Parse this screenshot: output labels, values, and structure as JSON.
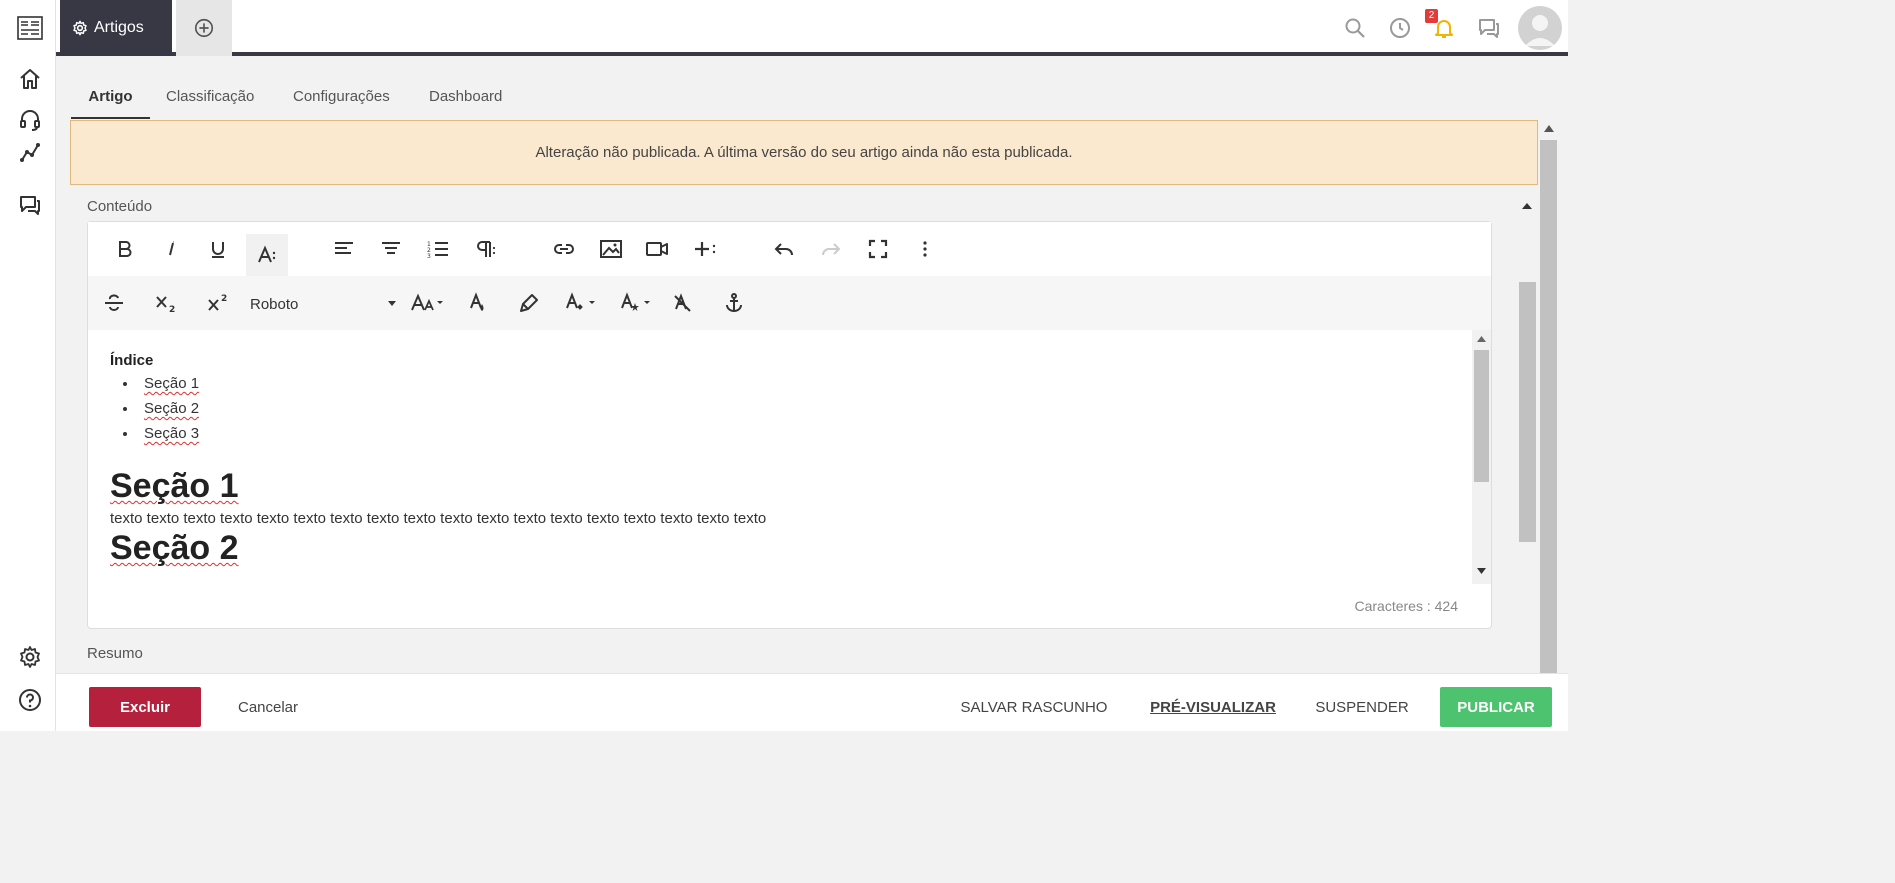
{
  "colors": {
    "accent_dark": "#383844",
    "alert_bg": "#fbe9cf",
    "danger": "#b5203c",
    "success": "#4ec36f",
    "badge": "#e23b3b"
  },
  "rail": {
    "icons": [
      "logo-icon",
      "home-icon",
      "headset-icon",
      "analytics-icon",
      "chat-icon",
      "settings-icon",
      "help-icon"
    ]
  },
  "topbar": {
    "active_tab": "Artigos",
    "notifications_count": "2",
    "icons": [
      "search-icon",
      "history-icon",
      "bell-icon",
      "messages-icon",
      "avatar"
    ]
  },
  "tabs": [
    "Artigo",
    "Classificação",
    "Configurações",
    "Dashboard"
  ],
  "alert": "Alteração não publicada. A última versão do seu artigo ainda não esta publicada.",
  "content_label": "Conteúdo",
  "editor": {
    "font": "Roboto",
    "toc_title": "Índice",
    "toc_items": [
      "Seção 1",
      "Seção 2",
      "Seção 3"
    ],
    "heading1": "Seção 1",
    "paragraph": "texto texto texto texto texto texto texto texto texto texto texto texto texto texto texto texto texto texto",
    "heading2": "Seção 2",
    "char_count": "Caracteres : 424"
  },
  "resumo_label": "Resumo",
  "footer": {
    "delete": "Excluir",
    "cancel": "Cancelar",
    "save_draft": "SALVAR RASCUNHO",
    "preview": "PRÉ-VISUALIZAR",
    "suspend": "SUSPENDER",
    "publish": "PUBLICAR"
  }
}
